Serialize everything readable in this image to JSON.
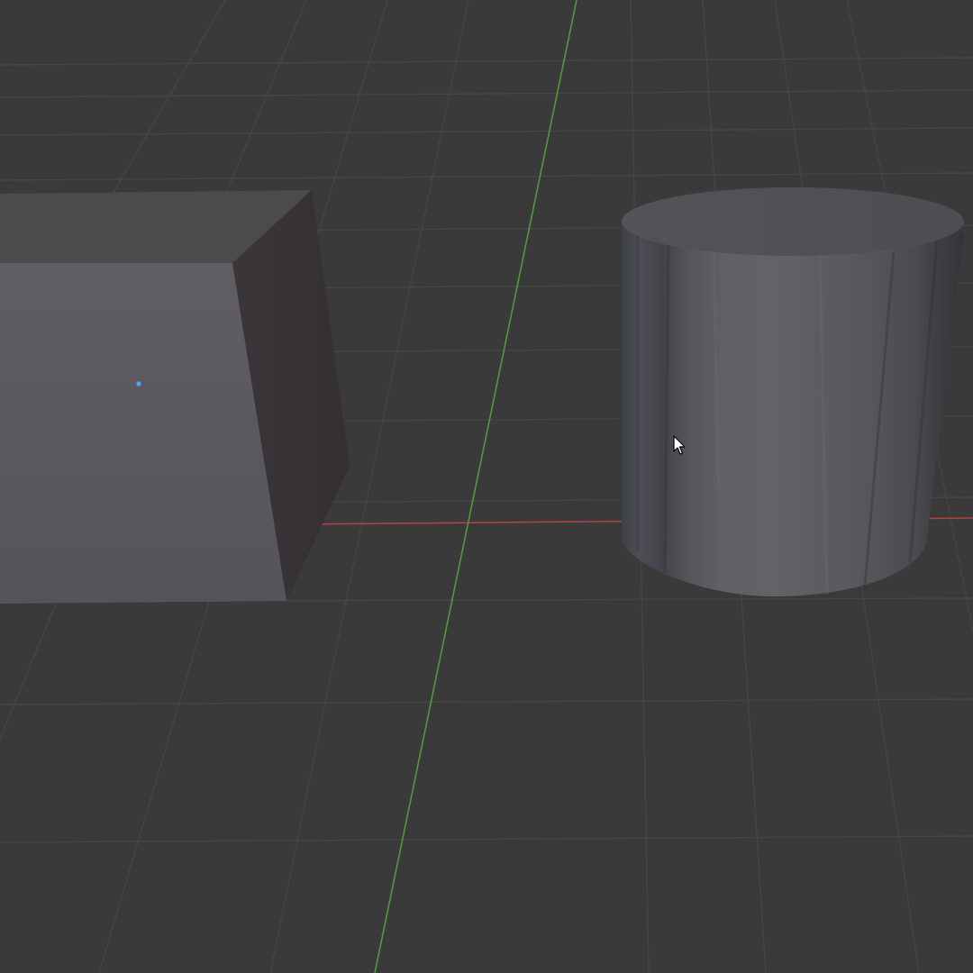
{
  "viewport": {
    "kind": "3d-viewport",
    "background_color": "#3a3a3a",
    "grid_line_color": "#454545",
    "x_axis_color": "#a8444a",
    "y_axis_color": "#4f9a3c"
  },
  "objects": [
    {
      "name": "cube",
      "shading": "solid",
      "front_face_color": "#5b5b60",
      "top_face_color": "#4b4a4d",
      "side_face_color": "#3a3538",
      "origin_color": "#4aa6ff"
    },
    {
      "name": "cylinder",
      "shading": "solid",
      "body_color": "#5c5c62",
      "top_face_color": "#545357"
    }
  ],
  "cursor": {
    "icon": "arrow-cursor-icon"
  }
}
